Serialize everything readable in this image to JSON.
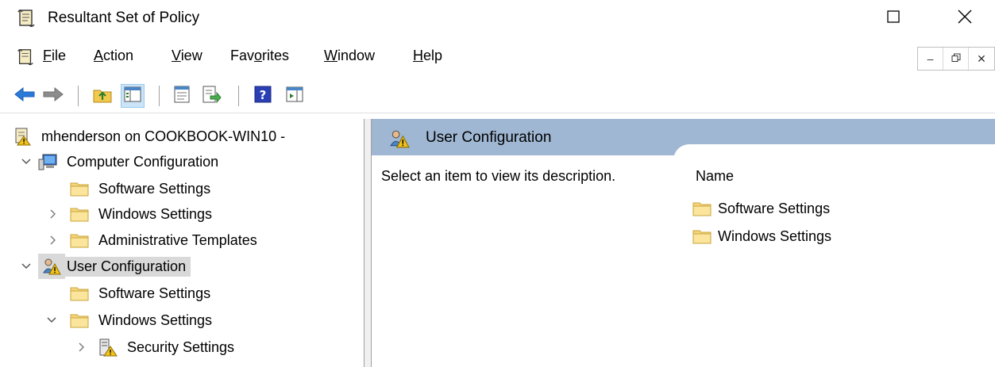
{
  "window": {
    "title": "Resultant Set of Policy",
    "maximize_glyph": "☐",
    "close_glyph": "✕"
  },
  "menu": {
    "items": [
      {
        "label": "File",
        "accel": "F"
      },
      {
        "label": "Action",
        "accel": "A"
      },
      {
        "label": "View",
        "accel": "V"
      },
      {
        "label": "Favorites",
        "accel": "o"
      },
      {
        "label": "Window",
        "accel": "W"
      },
      {
        "label": "Help",
        "accel": "H"
      }
    ],
    "mdi": {
      "minimize": "–",
      "restore": "🗗",
      "close": "✕"
    }
  },
  "toolbar": {
    "buttons": [
      "back-arrow-icon",
      "forward-arrow-icon",
      "up-folder-icon",
      "show-hide-tree-icon",
      "properties-icon",
      "export-list-icon",
      "help-icon",
      "action-pane-icon"
    ]
  },
  "tree": {
    "root": "mhenderson on COOKBOOK-WIN10 -",
    "computer_config": "Computer Configuration",
    "cc_software": "Software Settings",
    "cc_windows": "Windows Settings",
    "cc_admin": "Administrative Templates",
    "user_config": "User Configuration",
    "uc_software": "Software Settings",
    "uc_windows": "Windows Settings",
    "uc_security": "Security Settings",
    "chevron_collapsed": "›",
    "chevron_expanded": "⌄"
  },
  "details": {
    "header": "User Configuration",
    "description": "Select an item to view its description.",
    "column_name": "Name",
    "items": [
      "Software Settings",
      "Windows Settings"
    ]
  },
  "colors": {
    "header_band": "#9fb7d2",
    "selected_row": "#d9d9d9",
    "folder": "#f5d67b"
  }
}
